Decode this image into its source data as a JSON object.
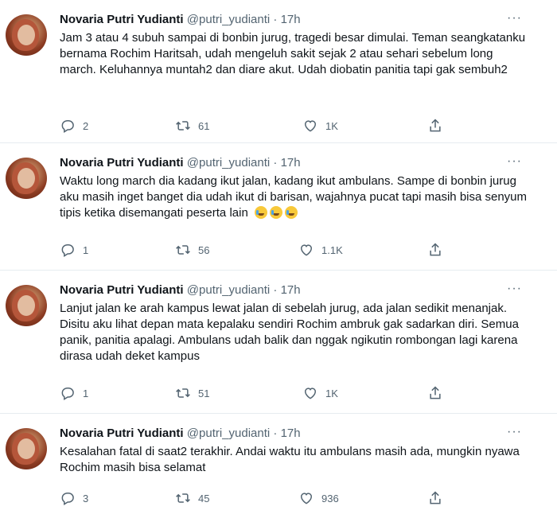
{
  "tweets": [
    {
      "name": "Novaria Putri Yudianti",
      "handle": "@putri_yudianti",
      "time": "17h",
      "text": "Jam 3 atau 4 subuh sampai di bonbin jurug, tragedi besar dimulai. Teman seangkatanku bernama Rochim Haritsah, udah mengeluh sakit sejak 2 atau sehari sebelum long march. Keluhannya muntah2 dan diare akut. Udah diobatin panitia tapi gak sembuh2",
      "emoji": [],
      "replies": "2",
      "retweets": "61",
      "likes": "1K"
    },
    {
      "name": "Novaria Putri Yudianti",
      "handle": "@putri_yudianti",
      "time": "17h",
      "text": "Waktu long march dia kadang ikut jalan, kadang ikut ambulans. Sampe di bonbin jurug aku masih inget banget dia udah ikut di barisan, wajahnya pucat tapi masih bisa senyum tipis ketika disemangati peserta lain",
      "emoji": [
        "crying-face",
        "crying-face",
        "crying-face"
      ],
      "replies": "1",
      "retweets": "56",
      "likes": "1.1K"
    },
    {
      "name": "Novaria Putri Yudianti",
      "handle": "@putri_yudianti",
      "time": "17h",
      "text": "Lanjut jalan ke arah kampus lewat jalan di sebelah jurug, ada jalan sedikit menanjak. Disitu aku lihat depan mata kepalaku sendiri Rochim ambruk gak sadarkan diri. Semua panik, panitia apalagi. Ambulans udah balik dan nggak ngikutin rombongan lagi karena dirasa udah deket kampus",
      "emoji": [],
      "replies": "1",
      "retweets": "51",
      "likes": "1K"
    },
    {
      "name": "Novaria Putri Yudianti",
      "handle": "@putri_yudianti",
      "time": "17h",
      "text": "Kesalahan fatal di saat2 terakhir. Andai waktu itu ambulans masih ada, mungkin nyawa Rochim masih bisa selamat",
      "emoji": [],
      "replies": "3",
      "retweets": "45",
      "likes": "936"
    }
  ],
  "separator": "·",
  "more_glyph": "···",
  "colors": {
    "text": "#0f1419",
    "muted": "#536471",
    "border": "#e6ecf0"
  }
}
